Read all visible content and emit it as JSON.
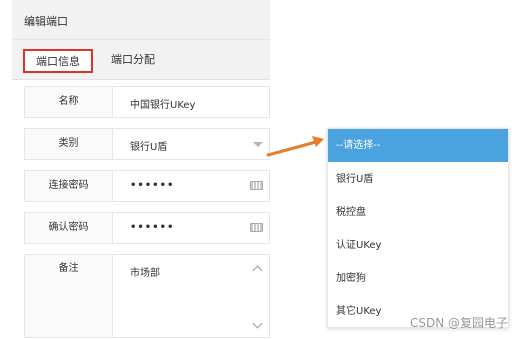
{
  "panel": {
    "title": "编辑端口"
  },
  "tabs": [
    {
      "label": "端口信息",
      "active": true
    },
    {
      "label": "端口分配",
      "active": false
    }
  ],
  "form": {
    "name": {
      "label": "名称",
      "value": "中国银行UKey"
    },
    "type": {
      "label": "类别",
      "value": "银行U盾"
    },
    "connect_password": {
      "label": "连接密码",
      "value": "••••••"
    },
    "confirm_password": {
      "label": "确认密码",
      "value": "••••••"
    },
    "remark": {
      "label": "备注",
      "value": "市场部"
    }
  },
  "dropdown": {
    "options": [
      "--请选择--",
      "银行U盾",
      "税控盘",
      "认证UKey",
      "加密狗",
      "其它UKey"
    ],
    "highlighted": "--请选择--"
  },
  "colors": {
    "tab_highlight": "#e0312b",
    "arrow": "#e87d2a",
    "option_highlight": "#4aa3df"
  },
  "watermark": "CSDN @复园电子"
}
